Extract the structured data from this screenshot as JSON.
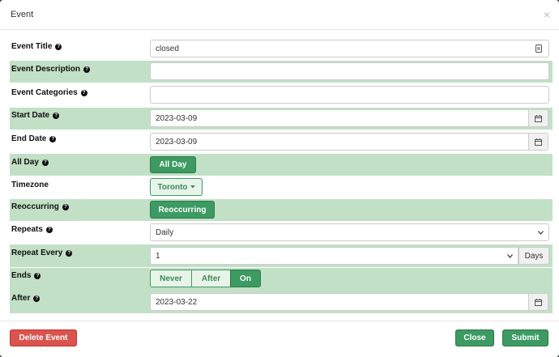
{
  "modal": {
    "title": "Event",
    "close_glyph": "×"
  },
  "fields": {
    "event_title": {
      "label": "Event Title",
      "value": "closed"
    },
    "event_description": {
      "label": "Event Description",
      "value": ""
    },
    "event_categories": {
      "label": "Event Categories",
      "value": ""
    },
    "start_date": {
      "label": "Start Date",
      "value": "2023-03-09"
    },
    "end_date": {
      "label": "End Date",
      "value": "2023-03-09"
    },
    "all_day": {
      "label": "All Day",
      "button": "All Day"
    },
    "timezone": {
      "label": "Timezone",
      "value": "Toronto"
    },
    "reoccurring": {
      "label": "Reoccurring",
      "button": "Reoccurring"
    },
    "repeats": {
      "label": "Repeats",
      "value": "Daily"
    },
    "repeat_every": {
      "label": "Repeat Every",
      "value": "1",
      "unit": "Days"
    },
    "ends": {
      "label": "Ends",
      "options": [
        "Never",
        "After",
        "On"
      ],
      "selected": "On"
    },
    "after": {
      "label": "After",
      "value": "2023-03-22"
    }
  },
  "footer": {
    "delete": "Delete Event",
    "close": "Close",
    "submit": "Submit"
  },
  "colors": {
    "accent": "#3c9a62",
    "row_highlight": "#c2e0c6",
    "danger": "#d9534f"
  },
  "icons": {
    "help": "question-circle-icon",
    "calendar": "calendar-icon",
    "chevron": "chevron-down-icon",
    "contact": "contact-card-icon"
  }
}
